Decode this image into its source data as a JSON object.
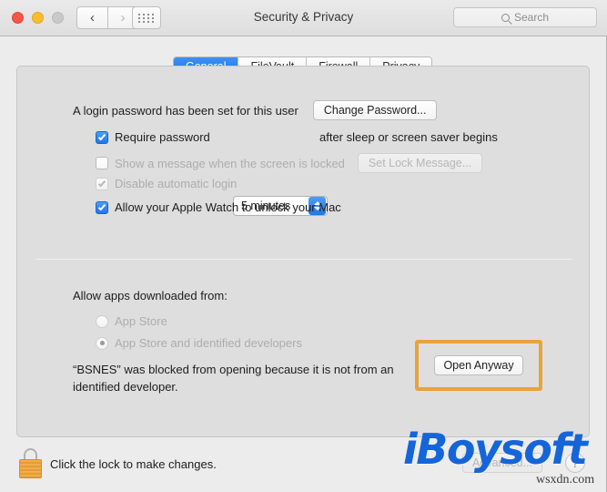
{
  "window": {
    "title": "Security & Privacy",
    "traffic_lights": [
      "close",
      "minimize",
      "zoom"
    ],
    "nav_back_icon": "chevron-left-icon",
    "nav_forward_icon": "chevron-right-icon",
    "show_all_icon": "grid-icon"
  },
  "search": {
    "placeholder": "Search",
    "value": "",
    "icon": "search-icon"
  },
  "tabs": [
    {
      "label": "General",
      "selected": true
    },
    {
      "label": "FileVault",
      "selected": false
    },
    {
      "label": "Firewall",
      "selected": false
    },
    {
      "label": "Privacy",
      "selected": false
    }
  ],
  "general": {
    "password_status": "A login password has been set for this user",
    "change_password_button": "Change Password...",
    "require_password": {
      "checked": true,
      "enabled": true,
      "label_before": "Require password",
      "interval_value": "5 minutes",
      "label_after": "after sleep or screen saver begins"
    },
    "show_message": {
      "checked": false,
      "enabled": false,
      "label": "Show a message when the screen is locked",
      "button": "Set Lock Message..."
    },
    "disable_auto_login": {
      "checked": true,
      "enabled": false,
      "label": "Disable automatic login"
    },
    "apple_watch": {
      "checked": true,
      "enabled": true,
      "label": "Allow your Apple Watch to unlock your Mac"
    }
  },
  "gatekeeper": {
    "heading": "Allow apps downloaded from:",
    "options": [
      {
        "label": "App Store",
        "selected": false,
        "enabled": false
      },
      {
        "label": "App Store and identified developers",
        "selected": true,
        "enabled": false
      }
    ],
    "blocked_message_line1": "“BSNES” was blocked from opening because it is not from an",
    "blocked_message_line2": "identified developer.",
    "open_anyway_button": "Open Anyway",
    "highlight_color": "#e8a33d"
  },
  "footer": {
    "lock_icon": "padlock-locked-icon",
    "lock_text": "Click the lock to make changes.",
    "advanced_button": "Advanced...",
    "advanced_enabled": false,
    "help_button": "?"
  },
  "overlay": {
    "watermark": "iBoysoft",
    "watermark_color": "#1565d8",
    "source_label": "wsxdn.com"
  }
}
